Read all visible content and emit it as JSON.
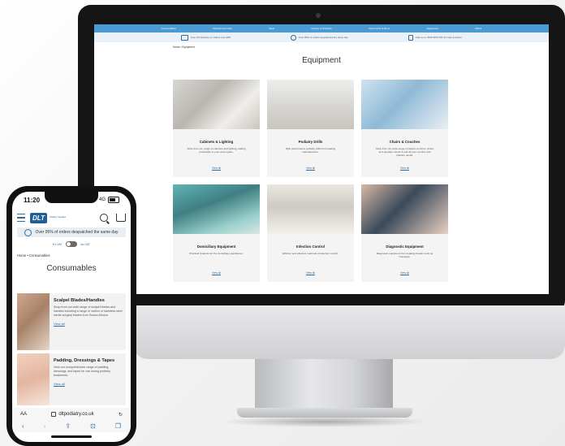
{
  "desktop": {
    "nav": [
      "Consumables",
      "Clinical Foot Care",
      "Wear",
      "Insoles & Orthotics",
      "Instruments & Burrs",
      "Equipment",
      "Offers"
    ],
    "info": [
      {
        "icon": "delivery-icon",
        "text": "Free UK Delivery on orders over £80"
      },
      {
        "icon": "badge-icon",
        "text": "Over 95% of orders despatched the same day"
      },
      {
        "icon": "phone-icon",
        "text": "Call us on 0345 9876 543 for help & advice"
      }
    ],
    "breadcrumb": "Home  •  Equipment",
    "title": "Equipment",
    "cards": [
      {
        "title": "Cabinets & Lighting",
        "desc": "Shop from our range of cabinets and lighting, adding practicality to your work space.",
        "link": "View all"
      },
      {
        "title": "Podiatry Drills",
        "desc": "High performance podiatry drills from leading manufacturers.",
        "link": "View all"
      },
      {
        "title": "Chairs & Couches",
        "desc": "Shop from our wide range of patient couches, chairs and operator stools to suit all your comfort and practice needs.",
        "link": "View all"
      },
      {
        "title": "Domiciliary Equipment",
        "desc": "Practical products for the domiciliary practitioner.",
        "link": "View all"
      },
      {
        "title": "Infection Control",
        "desc": "Efficient and effective methods of infection control.",
        "link": "View all"
      },
      {
        "title": "Diagnostic Equipment",
        "desc": "Diagnostic equipment from leading brands such as Huntleigh.",
        "link": "View all"
      }
    ]
  },
  "mobile": {
    "time": "11:20",
    "network": "4G",
    "logo_text": "DLT",
    "logo_sub": "Podiatry Supplies",
    "banner": "Over 95% of orders despatched the same day",
    "vat_ex": "Ex VAT",
    "vat_inc": "Inc VAT",
    "breadcrumb": "Home  •  Consumables",
    "title": "Consumables",
    "cards": [
      {
        "title": "Scalpel Blades/Handles",
        "desc": "Shop from our wide range of scalpel blades and handles including a range of carbon or stainless steel sterile surgical blades from Swann-Morton.",
        "link": "View all"
      },
      {
        "title": "Padding, Dressings & Tapes",
        "desc": "View our comprehensive range of padding, dressings, and tapes for use during podiatry treatments.",
        "link": "View all"
      }
    ],
    "url_aa": "AA",
    "url": "dltpodiatry.co.uk",
    "tab_icons": [
      "‹",
      "›",
      "⇪",
      "⊡",
      "❐"
    ]
  }
}
